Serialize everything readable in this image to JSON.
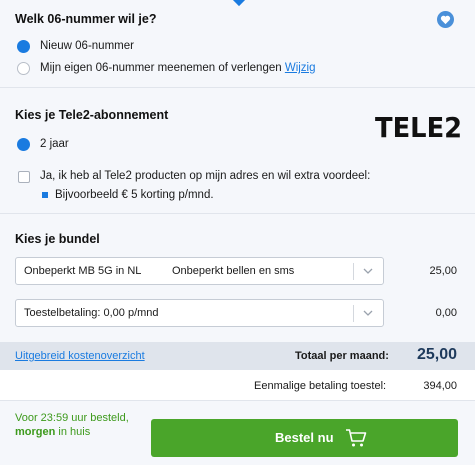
{
  "number": {
    "title": "Welk 06-nummer wil je?",
    "option_new": "Nieuw 06-nummer",
    "option_keep": "Mijn eigen 06-nummer meenemen of verlengen",
    "change_link": "Wijzig"
  },
  "subscription": {
    "title": "Kies je Tele2-abonnement",
    "logo": "TELE2",
    "duration": "2 jaar",
    "extra_check": "Ja, ik heb al Tele2 producten op mijn adres en wil extra voordeel:",
    "extra_example": "Bijvoorbeeld € 5 korting p/mnd."
  },
  "bundle": {
    "title": "Kies je bundel",
    "select_data": "Onbeperkt MB 5G in NL",
    "select_calls": "Onbeperkt bellen en sms",
    "bundle_price": "25,00",
    "device_payment": "Toestelbetaling: 0,00 p/mnd",
    "device_price": "0,00"
  },
  "totals": {
    "overview_link": "Uitgebreid kostenoverzicht",
    "monthly_label": "Totaal per maand:",
    "monthly_amount": "25,00",
    "once_label": "Eenmalige betaling toestel:",
    "once_amount": "394,00"
  },
  "footer": {
    "delivery_line1": "Voor 23:59 uur besteld,",
    "delivery_bold": "morgen",
    "delivery_rest": " in huis",
    "order_button": "Bestel nu"
  },
  "colors": {
    "accent": "#1a7be0",
    "order_green": "#4aa52a",
    "delivery_green": "#3d9a1c",
    "total_amount": "#1e3a5c"
  },
  "icons": [
    "heart-icon",
    "chevron-down-icon",
    "cart-icon"
  ]
}
